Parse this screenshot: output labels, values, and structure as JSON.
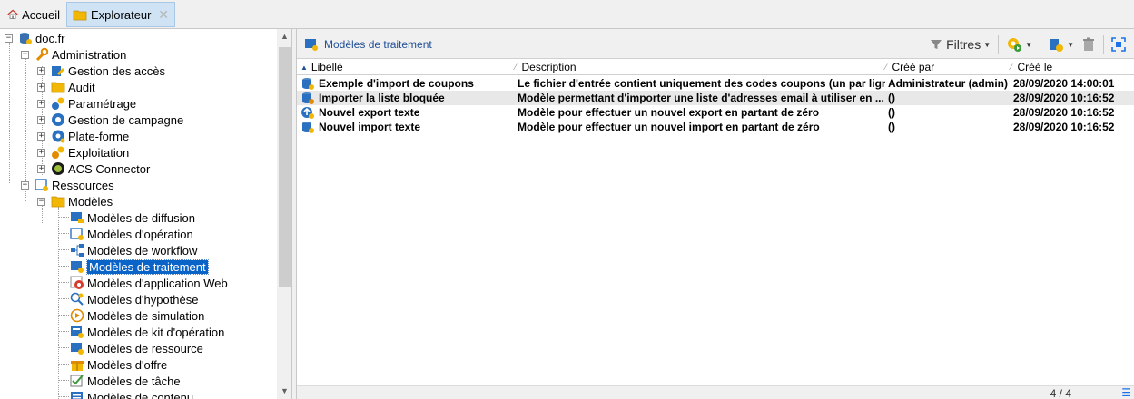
{
  "tabs": [
    {
      "label": "Accueil",
      "icon": "home-icon"
    },
    {
      "label": "Explorateur",
      "icon": "folder-icon",
      "close": "✕"
    }
  ],
  "tree": {
    "root": "doc.fr",
    "administration": {
      "label": "Administration",
      "children": [
        "Gestion des accès",
        "Audit",
        "Paramétrage",
        "Gestion de campagne",
        "Plate-forme",
        "Exploitation",
        "ACS Connector"
      ]
    },
    "ressources": {
      "label": "Ressources",
      "modeles": {
        "label": "Modèles",
        "children": [
          "Modèles de diffusion",
          "Modèles d'opération",
          "Modèles de workflow",
          "Modèles de traitement",
          "Modèles d'application Web",
          "Modèles d'hypothèse",
          "Modèles de simulation",
          "Modèles de kit d'opération",
          "Modèles de ressource",
          "Modèles d'offre",
          "Modèles de tâche",
          "Modèles de contenu"
        ]
      }
    },
    "selected": "Modèles de traitement"
  },
  "toolbar": {
    "title": "Modèles de traitement",
    "filters_label": "Filtres"
  },
  "grid": {
    "columns": [
      "Libellé",
      "Description",
      "Créé par",
      "Créé le"
    ],
    "rows": [
      {
        "label": "Exemple d'import de coupons",
        "description": "Le fichier d'entrée contient uniquement des codes coupons (un par lign...",
        "created_by": "Administrateur (admin)",
        "created_on": "28/09/2020 14:00:01"
      },
      {
        "label": "Importer la liste bloquée",
        "description": "Modèle permettant d'importer une liste d'adresses email à utiliser en ...",
        "created_by": "()",
        "created_on": "28/09/2020 10:16:52"
      },
      {
        "label": "Nouvel export texte",
        "description": "Modèle pour effectuer un nouvel export en partant de zéro",
        "created_by": "()",
        "created_on": "28/09/2020 10:16:52"
      },
      {
        "label": "Nouvel import texte",
        "description": "Modèle pour effectuer un nouvel import en partant de zéro",
        "created_by": "()",
        "created_on": "28/09/2020 10:16:52"
      }
    ]
  },
  "footer": {
    "count": "4 / 4"
  }
}
